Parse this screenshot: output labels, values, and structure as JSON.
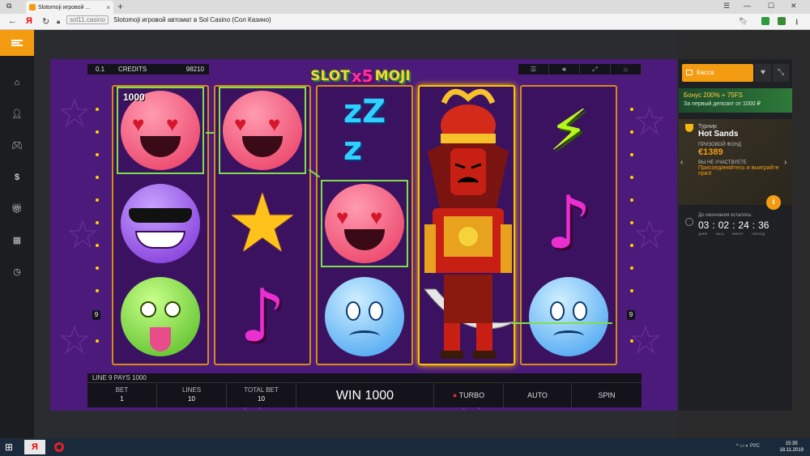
{
  "browser": {
    "tab_title": "Slotomoji игровой ...",
    "page_title": "Slotomoji игровой автомат в Sol Casino (Сол Казино)",
    "host": "sol11.casino",
    "search_letter": "Я"
  },
  "game": {
    "logo_left": "SLOT",
    "logo_mid": "x5",
    "logo_right": "MOJI",
    "top_left_value": "0.1",
    "credits_label": "CREDITS",
    "credits_value": "98210",
    "win_symbol_value": "1000",
    "line_number_left": "9",
    "line_number_right": "9",
    "payline_text": "LINE 9 PAYS 1000",
    "bet_label": "BET",
    "bet_value": "1",
    "lines_label": "LINES",
    "lines_value": "10",
    "total_bet_label": "TOTAL BET",
    "total_bet_value": "10",
    "win_text": "WIN 1000",
    "turbo_label": "TURBO",
    "auto_label": "AUTO",
    "spin_label": "SPIN",
    "reels": [
      [
        "love",
        "cool",
        "sick"
      ],
      [
        "love",
        "star",
        "note"
      ],
      [
        "zzz",
        "love",
        "sad"
      ],
      [
        "samurai"
      ],
      [
        "bolt",
        "note",
        "sad"
      ]
    ],
    "colors": {
      "accent": "#f39c12",
      "win_line": "#7de04a",
      "reel_border": "#d68a1a"
    }
  },
  "panel": {
    "kassa_label": "Касса",
    "bonus_title": "Бонус 200% + 75FS",
    "bonus_sub": "За первый депозит от 1000 ₽",
    "tournament_label": "Турнир",
    "tournament_name": "Hot Sands",
    "prize_label": "ПРИЗОВОЙ ФОНД",
    "prize_value": "€1389",
    "not_participating": "ВЫ НЕ УЧАСТВУЕТЕ",
    "join_text": "Присоединяйтесь и выиграйте приз!",
    "countdown_label": "До окончания осталось:",
    "days": "03",
    "hours": "02",
    "minutes": "24",
    "seconds": "36",
    "days_unit": "ДНЕЙ",
    "hours_unit": "ЧАСА",
    "minutes_unit": "МИНУТ",
    "seconds_unit": "СЕКУНД"
  },
  "taskbar": {
    "lang": "РУС",
    "time": "15:35",
    "date": "18.11.2019"
  }
}
